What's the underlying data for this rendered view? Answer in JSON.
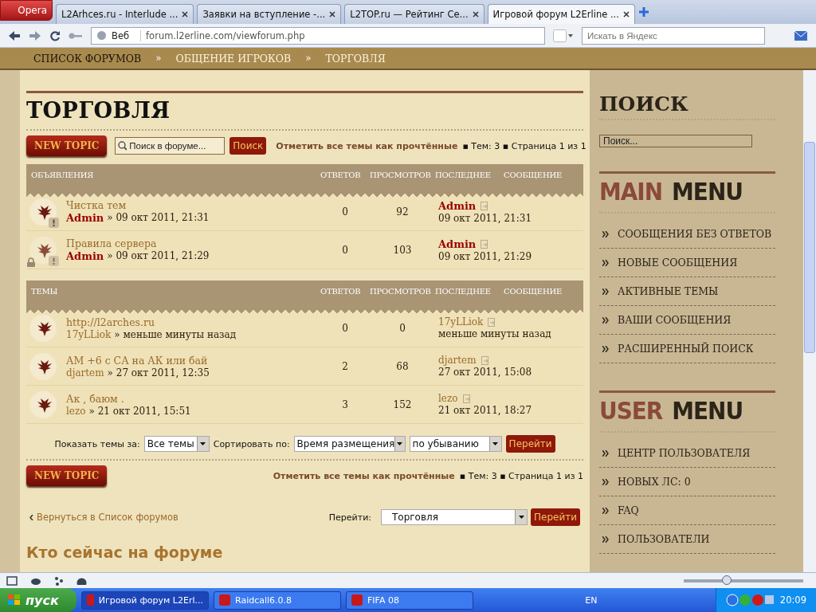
{
  "browser": {
    "menu_button": "Opera",
    "tabs": [
      {
        "label": "L2Arhces.ru - Interlude ...",
        "selected": false
      },
      {
        "label": "Заявки на вступление -...",
        "selected": false
      },
      {
        "label": "L2TOP.ru — Рейтинг Се...",
        "selected": false
      },
      {
        "label": "Игровой форум L2Erline ...",
        "selected": true
      }
    ],
    "address": {
      "prefix": "Веб",
      "url": "forum.l2erline.com/viewforum.php"
    },
    "search": {
      "placeholder": "Искать в Яндекс"
    }
  },
  "breadcrumbs": {
    "separator": "»",
    "items": [
      "СПИСОК ФОРУМОВ",
      "ОБЩЕНИЕ ИГРОКОВ",
      "ТОРГОВЛЯ"
    ]
  },
  "forum": {
    "title": "ТОРГОВЛЯ",
    "search": {
      "placeholder": "Поиск в форуме...",
      "button": "Поиск"
    },
    "top_bar": {
      "new_topic": "NEW TOPIC",
      "mark_read": "Отметить все темы как прочтённые",
      "pagination": "▪ Тем: 3 ▪ Страница 1 из 1"
    },
    "bottom_bar": {
      "new_topic": "NEW TOPIC",
      "mark_read": "Отметить все темы как прочтённые",
      "pagination": "▪ Тем: 3 ▪ Страница 1 из 1"
    },
    "sections": [
      {
        "title": "ОБЪЯВЛЕНИЯ",
        "columns": [
          "ОТВЕТОВ",
          "ПРОСМОТРОВ",
          "ПОСЛЕДНЕЕ",
          "СООБЩЕНИЕ"
        ],
        "topics": [
          {
            "kind": "announcement",
            "locked": false,
            "title": "Чистка тем",
            "author": {
              "name": "Admin",
              "color": "#990000"
            },
            "date": "» 09 окт 2011, 21:31",
            "replies": "0",
            "views": "92",
            "last_author": {
              "name": "Admin",
              "color": "#990000"
            },
            "last_date": "09 окт 2011, 21:31"
          },
          {
            "kind": "announcement",
            "locked": true,
            "title": "Правила сервера",
            "author": {
              "name": "Admin",
              "color": "#990000"
            },
            "date": "» 09 окт 2011, 21:29",
            "replies": "0",
            "views": "103",
            "last_author": {
              "name": "Admin",
              "color": "#990000"
            },
            "last_date": "09 окт 2011, 21:29"
          }
        ]
      },
      {
        "title": "ТЕМЫ",
        "columns": [
          "ОТВЕТОВ",
          "ПРОСМОТРОВ",
          "ПОСЛЕДНЕЕ",
          "СООБЩЕНИЕ"
        ],
        "topics": [
          {
            "kind": "topic",
            "locked": false,
            "title": "http://l2arches.ru",
            "author": {
              "name": "17yLLiok",
              "color": "#9a6a2a"
            },
            "date": "» меньше минуты назад",
            "replies": "0",
            "views": "0",
            "last_author": {
              "name": "17yLLiok",
              "color": "#9a6a2a"
            },
            "last_date": "меньше минуты назад"
          },
          {
            "kind": "topic",
            "locked": false,
            "title": "АМ +6 с СА на АК или бай",
            "author": {
              "name": "djartem",
              "color": "#9a6a2a"
            },
            "date": "» 27 окт 2011, 12:35",
            "replies": "2",
            "views": "68",
            "last_author": {
              "name": "djartem",
              "color": "#9a6a2a"
            },
            "last_date": "27 окт 2011, 15:08"
          },
          {
            "kind": "topic",
            "locked": false,
            "title": "Ак , баюм .",
            "author": {
              "name": "lezo",
              "color": "#9a6a2a"
            },
            "date": "» 21 окт 2011, 15:51",
            "replies": "3",
            "views": "152",
            "last_author": {
              "name": "lezo",
              "color": "#9a6a2a"
            },
            "last_date": "21 окт 2011, 18:27"
          }
        ]
      }
    ],
    "filters": {
      "show_label": "Показать темы за:",
      "show_value": "Все темы",
      "sort_label": "Сортировать по:",
      "sort_value": "Время размещения",
      "order_value": "по убыванию",
      "button": "Перейти"
    },
    "back_link": "Вернуться в Список форумов",
    "jump": {
      "label": "Перейти:",
      "value": "Торговля",
      "button": "Перейти"
    },
    "who_online": "Кто сейчас на форуме"
  },
  "sidebar": {
    "search_title": "ПОИСК",
    "search_placeholder": "Поиск...",
    "menus": [
      {
        "accent": "MAIN",
        "title": "MENU",
        "items": [
          "СООБЩЕНИЯ БЕЗ ОТВЕТОВ",
          "НОВЫЕ СООБЩЕНИЯ",
          "АКТИВНЫЕ ТЕМЫ",
          "ВАШИ СООБЩЕНИЯ",
          "РАСШИРЕННЫЙ ПОИСК"
        ]
      },
      {
        "accent": "USER",
        "title": "MENU",
        "items": [
          "ЦЕНТР ПОЛЬЗОВАТЕЛЯ",
          "НОВЫХ ЛС: 0",
          "FAQ",
          "ПОЛЬЗОВАТЕЛИ"
        ]
      }
    ]
  },
  "status_bar": {
    "zoom": {
      "level": 0.36
    }
  },
  "taskbar": {
    "start": "пуск",
    "tasks": [
      {
        "label": "Игровой форум L2Erl...",
        "selected": true
      },
      {
        "label": "Raidcall6.0.8",
        "selected": false
      },
      {
        "label": "FIFA 08",
        "selected": false
      }
    ],
    "language": "EN",
    "clock": "20:09"
  }
}
